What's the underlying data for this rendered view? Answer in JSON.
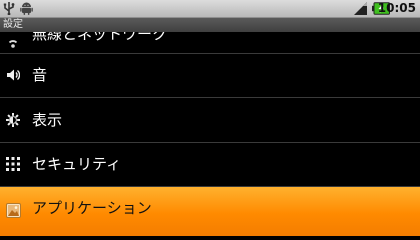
{
  "status_bar": {
    "time": "10:05",
    "icons": [
      "usb-icon",
      "android-icon",
      "signal-icon",
      "battery-charging-icon"
    ],
    "battery_color": "#3fbf1f"
  },
  "title_bar": {
    "title": "設定"
  },
  "settings_list": {
    "items": [
      {
        "label": "無線とネットワーク",
        "icon": "wireless-icon"
      },
      {
        "label": "音",
        "icon": "sound-icon"
      },
      {
        "label": "表示",
        "icon": "display-icon"
      },
      {
        "label": "セキュリティ",
        "icon": "security-grid-icon"
      },
      {
        "label": "アプリケーション",
        "icon": "applications-icon",
        "selected": true
      }
    ],
    "selection_color": "#ff9200"
  }
}
